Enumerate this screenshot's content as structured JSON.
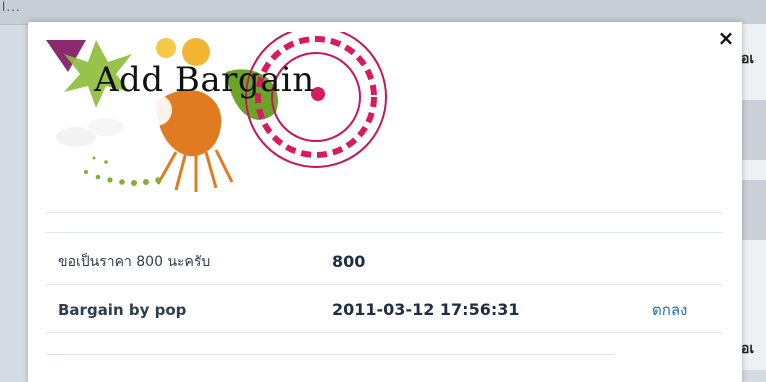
{
  "background": {
    "dots": "l...",
    "right_text_1": "อเ",
    "right_text_2": "อเ"
  },
  "modal": {
    "title": "Add Bargain",
    "close_symbol": "×",
    "rows": [
      {
        "label": "ขอเป็นราคา 800 นะครับ",
        "value": "800",
        "action": ""
      },
      {
        "label": "Bargain by pop",
        "value": "2011-03-12 17:56:31",
        "action": "ตกลง"
      }
    ]
  }
}
